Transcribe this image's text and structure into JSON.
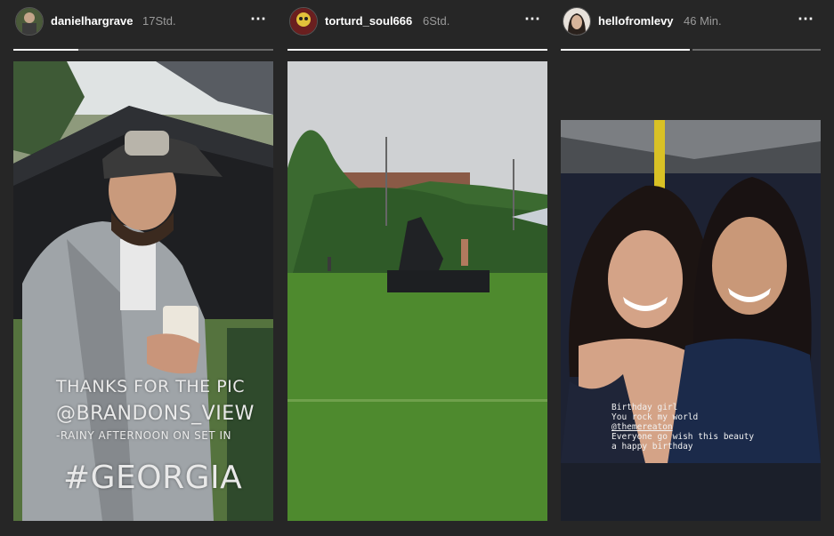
{
  "stories": [
    {
      "username": "danielhargrave",
      "time": "17Std.",
      "caption_lines": [
        "THANKS FOR THE PIC",
        "@BRANDONS_VIEW",
        "-RAINY AFTERNOON ON SET IN",
        "#GEORGIA"
      ]
    },
    {
      "username": "torturd_soul666",
      "time": "6Std."
    },
    {
      "username": "hellofromlevy",
      "time": "46 Min.",
      "caption_lines": [
        "Birthday girl",
        "You rock my world",
        "@themereaton",
        "Everyone go wish this beauty",
        "a happy birthday"
      ]
    }
  ],
  "more_icon": "⋯",
  "progress": {
    "story1": [
      0.25
    ],
    "story2": [
      1.0
    ],
    "story3": [
      1.0,
      0.0
    ]
  }
}
